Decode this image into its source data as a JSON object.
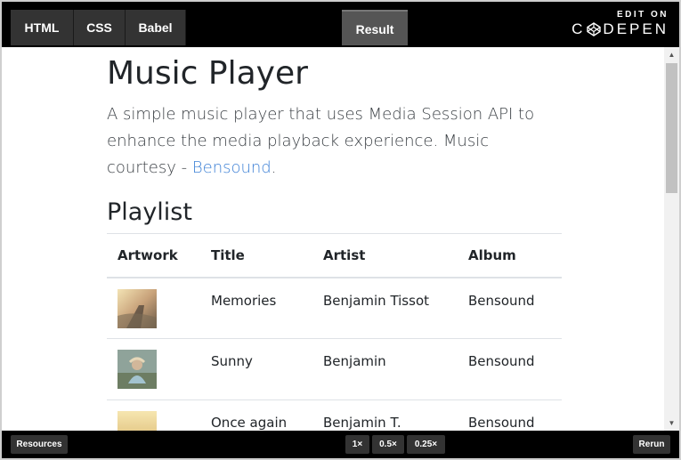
{
  "editor": {
    "tabs": [
      "HTML",
      "CSS",
      "Babel"
    ],
    "result_tab": "Result",
    "edit_on": "EDIT ON",
    "brand": "CODEPEN"
  },
  "page": {
    "title": "Music Player",
    "lead": "A simple music player that uses Media Session API to enhance the media playback experience. Music courtesy - ",
    "lead_link": "Bensound",
    "lead_end": ".",
    "playlist_heading": "Playlist",
    "columns": [
      "Artwork",
      "Title",
      "Artist",
      "Album"
    ],
    "rows": [
      {
        "title": "Memories",
        "artist": "Benjamin Tissot",
        "album": "Bensound"
      },
      {
        "title": "Sunny",
        "artist": "Benjamin",
        "album": "Bensound"
      },
      {
        "title": "Once again",
        "artist": "Benjamin T.",
        "album": "Bensound"
      }
    ]
  },
  "footer": {
    "resources": "Resources",
    "zoom": [
      "1×",
      "0.5×",
      "0.25×"
    ],
    "rerun": "Rerun"
  },
  "colors": {
    "link": "#3f82d6",
    "topbar": "#000000",
    "tab": "#333333"
  }
}
